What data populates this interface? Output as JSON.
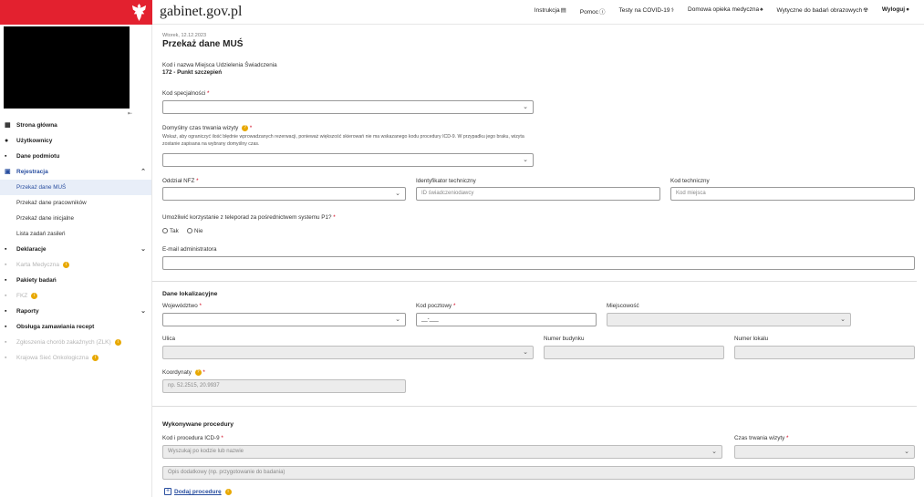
{
  "header": {
    "site_title": "gabinet.gov.pl",
    "nav": [
      {
        "label": "Instrukcja",
        "icon": "document-icon"
      },
      {
        "label": "Pomoc",
        "icon": "help-icon"
      },
      {
        "label": "Testy na COVID-19",
        "icon": "syringe-icon"
      },
      {
        "label": "Domowa opieka medyczna",
        "icon": "lungs-icon"
      },
      {
        "label": "Wytyczne do badań obrazowych",
        "icon": "radiation-icon"
      },
      {
        "label": "Wyloguj",
        "icon": "user-icon"
      }
    ]
  },
  "sidebar": {
    "items": [
      {
        "label": "Strona główna",
        "icon": "dashboard-icon"
      },
      {
        "label": "Użytkownicy",
        "icon": "user-icon"
      },
      {
        "label": "Dane podmiotu",
        "icon": "file-icon"
      },
      {
        "label": "Rejestracja",
        "icon": "calendar-icon"
      },
      {
        "label": "Deklaracje",
        "icon": "file-icon"
      },
      {
        "label": "Karta Medyczna",
        "icon": "file-icon"
      },
      {
        "label": "Pakiety badań",
        "icon": "file-icon"
      },
      {
        "label": "FKZ",
        "icon": "file-icon"
      },
      {
        "label": "Raporty",
        "icon": "file-icon"
      },
      {
        "label": "Obsługa zamawiania recept",
        "icon": "file-icon"
      },
      {
        "label": "Zgłoszenia chorób zakaźnych (ZLK)",
        "icon": "file-icon"
      },
      {
        "label": "Krajowa Sieć Onkologiczna",
        "icon": "file-icon"
      }
    ],
    "sub_items": [
      {
        "label": "Przekaż dane MUŚ"
      },
      {
        "label": "Przekaż dane pracowników"
      },
      {
        "label": "Przekaż dane inicjalne"
      },
      {
        "label": "Lista zadań zasileń"
      }
    ]
  },
  "main": {
    "date": "Wtorek, 12.12.2023",
    "title": "Przekaż dane MUŚ",
    "place_label": "Kod i nazwa Miejsca Udzielenia Świadczenia",
    "place_value": "172 - Punkt szczepień",
    "spec_label": "Kod specjalności",
    "duration_label": "Domyślny czas trwania wizyty",
    "duration_hint": "Wskaż, aby ograniczyć ilość błędnie wprowadzanych rezerwacji, ponieważ większość skierowań nie ma wskazanego kodu procedury ICD-9. W przypadku jego braku, wizyta zostanie zapisana na wybrany domyślny czas.",
    "nfz_label": "Oddział NFZ",
    "tech_id_label": "Identyfikator techniczny",
    "tech_id_placeholder": "ID świadczeniodawcy",
    "tech_code_label": "Kod techniczny",
    "tech_code_placeholder": "Kod miejsca",
    "teleporad_label": "Umożliwić korzystanie z teleporad za pośrednictwem systemu P1?",
    "yes": "Tak",
    "no": "Nie",
    "email_label": "E-mail administratora",
    "location_section": "Dane lokalizacyjne",
    "voivodeship_label": "Województwo",
    "postal_label": "Kod pocztowy",
    "postal_value": "__-___",
    "city_label": "Miejscowość",
    "street_label": "Ulica",
    "building_label": "Numer budynku",
    "unit_label": "Numer lokalu",
    "coords_label": "Koordynaty",
    "coords_placeholder": "np. 52.2515, 20.9937",
    "procedures_section": "Wykonywane procedury",
    "icd_label": "Kod i procedura ICD-9",
    "icd_placeholder": "Wyszukaj po kodzie lub nazwie",
    "visit_duration_label": "Czas trwania wizyty",
    "extra_placeholder": "Opis dodatkowy (np. przygotowanie do badania)",
    "add_procedure": "Dodaj procedurę",
    "required_mark": "*"
  },
  "colors": {
    "brand_red": "#e3212f",
    "accent_blue": "#2a4fa0",
    "info_orange": "#e8a800"
  }
}
